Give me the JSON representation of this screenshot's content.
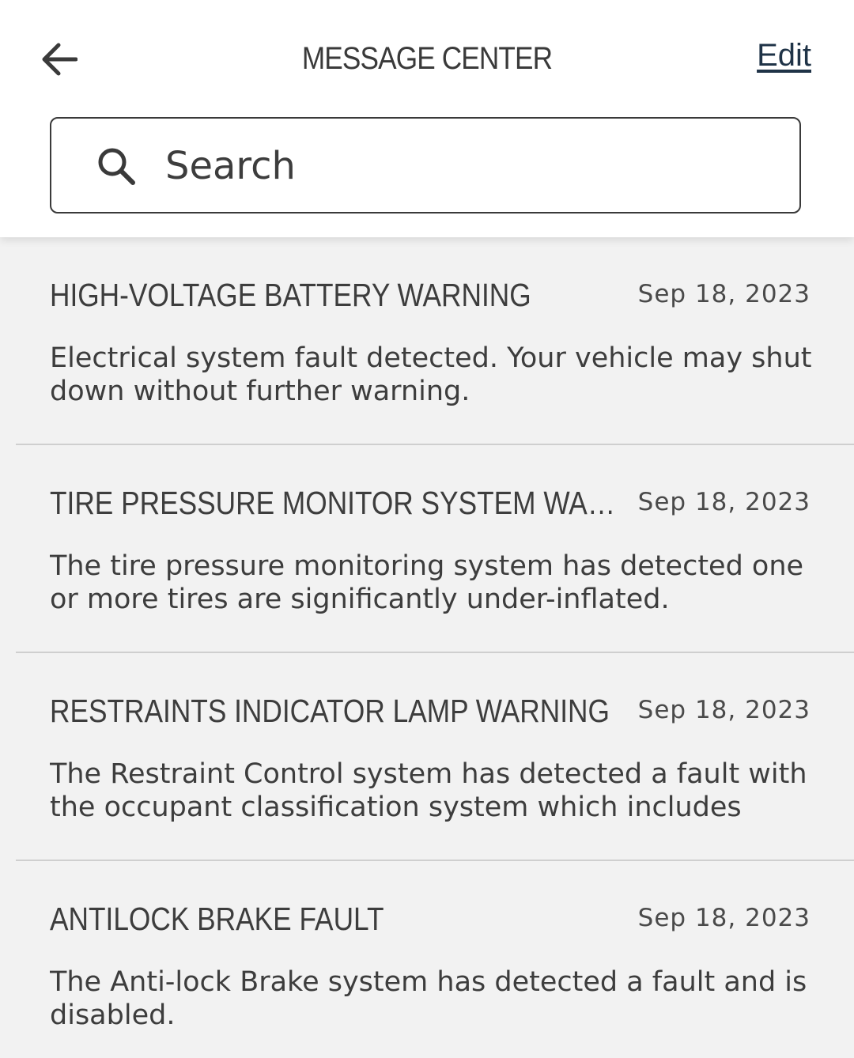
{
  "header": {
    "title": "MESSAGE CENTER",
    "edit_label": "Edit",
    "back_icon": "arrow-left-icon"
  },
  "search": {
    "placeholder": "Search",
    "icon": "search-icon"
  },
  "messages": [
    {
      "title": "HIGH-VOLTAGE BATTERY WARNING",
      "date": "Sep 18, 2023",
      "body": "Electrical system fault detected. Your vehicle may shut down without further warning."
    },
    {
      "title": "TIRE PRESSURE MONITOR SYSTEM WARNI...",
      "date": "Sep 18, 2023",
      "body": "The tire pressure monitoring system has detected one or more tires are significantly under-inflated."
    },
    {
      "title": "RESTRAINTS INDICATOR LAMP WARNING",
      "date": "Sep 18, 2023",
      "body": "The Restraint Control system has detected a fault with the occupant classification system which includes the..."
    },
    {
      "title": "ANTILOCK BRAKE FAULT",
      "date": "Sep 18, 2023",
      "body": "The Anti-lock Brake system has detected a fault and is disabled."
    }
  ],
  "colors": {
    "background": "#f2f2f2",
    "header_background": "#ffffff",
    "text": "#3d3d3d",
    "link": "#1f3347",
    "divider": "#cfcfcf"
  }
}
